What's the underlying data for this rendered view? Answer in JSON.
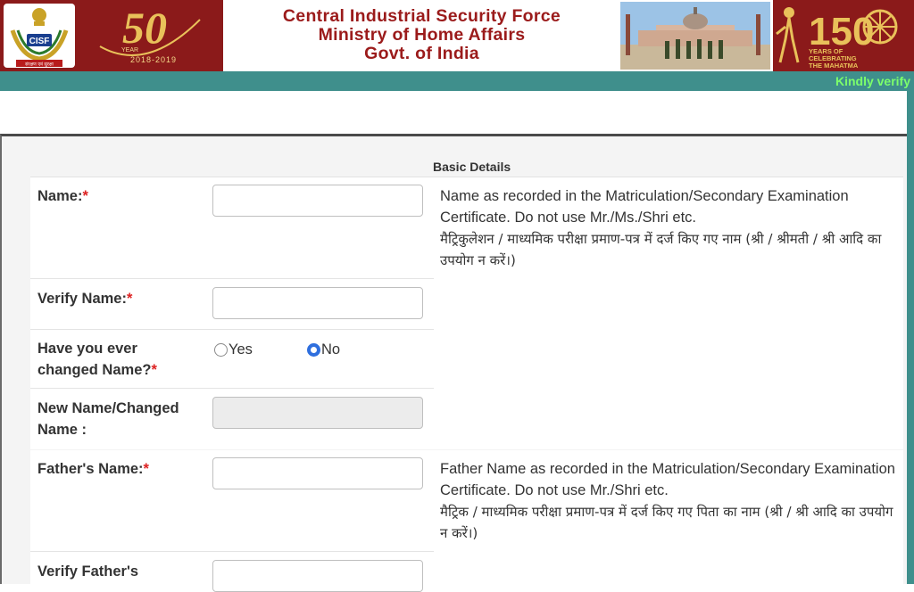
{
  "header": {
    "cisf_logo_text": "CISF",
    "cisf_motto": "संरक्षण एवं सुरक्षा",
    "fifty_number": "50",
    "fifty_year_label": "YEAR",
    "fifty_years": "2018-2019",
    "title_line1": "Central Industrial Security Force",
    "title_line2": "Ministry of Home Affairs",
    "title_line3": "Govt. of India",
    "mahatma_number": "150",
    "mahatma_text1": "YEARS OF",
    "mahatma_text2": "CELEBRATING",
    "mahatma_text3": "THE MAHATMA"
  },
  "marquee": {
    "text": "Kindly verify"
  },
  "form": {
    "section_title": "Basic Details",
    "name": {
      "label": "Name:",
      "required_mark": "*",
      "hint_en": "Name as recorded in the Matriculation/Secondary Examination Certificate. Do not use Mr./Ms./Shri etc.",
      "hint_hi": "मैट्रिकुलेशन / माध्यमिक परीक्षा प्रमाण-पत्र में दर्ज किए गए नाम (श्री / श्रीमती / श्री आदि का उपयोग न करें।)",
      "value": ""
    },
    "verify_name": {
      "label": "Verify Name:",
      "required_mark": "*",
      "value": ""
    },
    "changed_name": {
      "label_line1": "Have you ever",
      "label_line2": "changed Name?",
      "required_mark": "*",
      "option_yes": "Yes",
      "option_no": "No",
      "selected": "No"
    },
    "new_name": {
      "label_line1": "New Name/Changed",
      "label_line2": "Name :",
      "value": ""
    },
    "father_name": {
      "label": "Father's Name:",
      "required_mark": "*",
      "hint_en": "Father Name as recorded in the Matriculation/Secondary Examination Certificate. Do not use Mr./Shri etc.",
      "hint_hi": "मैट्रिक / माध्यमिक परीक्षा प्रमाण-पत्र में दर्ज किए गए पिता का नाम (श्री / श्री आदि का उपयोग न करें।)",
      "value": ""
    },
    "verify_father_name": {
      "label": "Verify Father's",
      "value": ""
    }
  },
  "colors": {
    "brand_maroon": "#8b1a1a",
    "title_red": "#9b1b1b",
    "teal_bar": "#3f8f8c",
    "marquee_green": "#7cff6b",
    "radio_blue": "#2f6fde",
    "required_red": "#d22222"
  }
}
